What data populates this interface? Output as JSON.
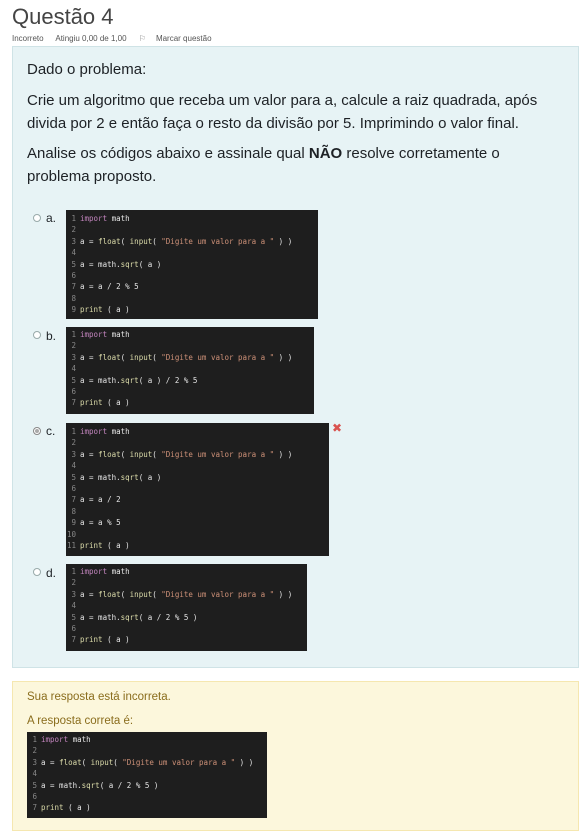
{
  "header": {
    "title": "Questão 4",
    "status": "Incorreto",
    "grade": "Atingiu 0,00 de 1,00",
    "flag_label": "Marcar questão"
  },
  "question": {
    "p1": "Dado o problema:",
    "p2": "Crie um algoritmo que receba um valor para a, calcule a raiz quadrada, após divida por 2 e então faça o resto da divisão por 5. Imprimindo o valor final.",
    "p3_before": "Analise os códigos abaixo e assinale qual ",
    "p3_bold": "NÃO",
    "p3_after": " resolve corretamente o problema proposto."
  },
  "options": [
    {
      "letter": "a.",
      "selected": false,
      "code": [
        {
          "n": "1",
          "t": [
            [
              "kw",
              "import"
            ],
            [
              "",
              " math"
            ]
          ]
        },
        {
          "n": "2",
          "t": []
        },
        {
          "n": "3",
          "t": [
            [
              "",
              "a = "
            ],
            [
              "fn",
              "float"
            ],
            [
              "",
              "( "
            ],
            [
              "fn",
              "input"
            ],
            [
              "",
              "( "
            ],
            [
              "str",
              "\"Digite um valor para a \""
            ],
            [
              "",
              " ) )"
            ]
          ]
        },
        {
          "n": "4",
          "t": []
        },
        {
          "n": "5",
          "t": [
            [
              "",
              "a = math."
            ],
            [
              "fn",
              "sqrt"
            ],
            [
              "",
              "( a )"
            ]
          ]
        },
        {
          "n": "6",
          "t": []
        },
        {
          "n": "7",
          "t": [
            [
              "",
              "a = a / 2 % 5"
            ]
          ]
        },
        {
          "n": "8",
          "t": []
        },
        {
          "n": "9",
          "t": [
            [
              "fn",
              "print"
            ],
            [
              "",
              " ( a )"
            ]
          ]
        }
      ]
    },
    {
      "letter": "b.",
      "selected": false,
      "code": [
        {
          "n": "1",
          "t": [
            [
              "kw",
              "import"
            ],
            [
              "",
              " math"
            ]
          ]
        },
        {
          "n": "2",
          "t": []
        },
        {
          "n": "3",
          "t": [
            [
              "",
              "a = "
            ],
            [
              "fn",
              "float"
            ],
            [
              "",
              "( "
            ],
            [
              "fn",
              "input"
            ],
            [
              "",
              "( "
            ],
            [
              "str",
              "\"Digite um valor para a \""
            ],
            [
              "",
              " ) )"
            ]
          ]
        },
        {
          "n": "4",
          "t": []
        },
        {
          "n": "5",
          "t": [
            [
              "",
              "a = math."
            ],
            [
              "fn",
              "sqrt"
            ],
            [
              "",
              "( a ) / 2 % 5"
            ]
          ]
        },
        {
          "n": "6",
          "t": []
        },
        {
          "n": "7",
          "t": [
            [
              "fn",
              "print"
            ],
            [
              "",
              " ( a )"
            ]
          ]
        }
      ]
    },
    {
      "letter": "c.",
      "selected": true,
      "code": [
        {
          "n": "1",
          "t": [
            [
              "kw",
              "import"
            ],
            [
              "",
              " math"
            ]
          ]
        },
        {
          "n": "2",
          "t": []
        },
        {
          "n": "3",
          "t": [
            [
              "",
              "a = "
            ],
            [
              "fn",
              "float"
            ],
            [
              "",
              "( "
            ],
            [
              "fn",
              "input"
            ],
            [
              "",
              "( "
            ],
            [
              "str",
              "\"Digite um valor para a \""
            ],
            [
              "",
              " ) )"
            ]
          ]
        },
        {
          "n": "4",
          "t": []
        },
        {
          "n": "5",
          "t": [
            [
              "",
              "a = math."
            ],
            [
              "fn",
              "sqrt"
            ],
            [
              "",
              "( a )"
            ]
          ]
        },
        {
          "n": "6",
          "t": []
        },
        {
          "n": "7",
          "t": [
            [
              "",
              "a = a / 2"
            ]
          ]
        },
        {
          "n": "8",
          "t": []
        },
        {
          "n": "9",
          "t": [
            [
              "",
              "a = a % 5"
            ]
          ]
        },
        {
          "n": "10",
          "t": []
        },
        {
          "n": "11",
          "t": [
            [
              "fn",
              "print"
            ],
            [
              "",
              " ( a )"
            ]
          ]
        }
      ]
    },
    {
      "letter": "d.",
      "selected": false,
      "code": [
        {
          "n": "1",
          "t": [
            [
              "kw",
              "import"
            ],
            [
              "",
              " math"
            ]
          ]
        },
        {
          "n": "2",
          "t": []
        },
        {
          "n": "3",
          "t": [
            [
              "",
              "a = "
            ],
            [
              "fn",
              "float"
            ],
            [
              "",
              "( "
            ],
            [
              "fn",
              "input"
            ],
            [
              "",
              "( "
            ],
            [
              "str",
              "\"Digite um valor para a \""
            ],
            [
              "",
              " ) )"
            ]
          ]
        },
        {
          "n": "4",
          "t": []
        },
        {
          "n": "5",
          "t": [
            [
              "",
              "a = math."
            ],
            [
              "fn",
              "sqrt"
            ],
            [
              "",
              "( a / 2 % 5 )"
            ]
          ]
        },
        {
          "n": "6",
          "t": []
        },
        {
          "n": "7",
          "t": [
            [
              "fn",
              "print"
            ],
            [
              "",
              " ( a )"
            ]
          ]
        }
      ]
    }
  ],
  "feedback": {
    "incorrect_msg": "Sua resposta está incorreta.",
    "correct_label": "A resposta correta é:",
    "code": [
      {
        "n": "1",
        "t": [
          [
            "kw",
            "import"
          ],
          [
            "",
            " math"
          ]
        ]
      },
      {
        "n": "2",
        "t": []
      },
      {
        "n": "3",
        "t": [
          [
            "",
            "a = "
          ],
          [
            "fn",
            "float"
          ],
          [
            "",
            "( "
          ],
          [
            "fn",
            "input"
          ],
          [
            "",
            "( "
          ],
          [
            "str",
            "\"Digite um valor para a \""
          ],
          [
            "",
            " ) )"
          ]
        ]
      },
      {
        "n": "4",
        "t": []
      },
      {
        "n": "5",
        "t": [
          [
            "",
            "a = math."
          ],
          [
            "fn",
            "sqrt"
          ],
          [
            "",
            "( a / 2 % 5 )"
          ]
        ]
      },
      {
        "n": "6",
        "t": []
      },
      {
        "n": "7",
        "t": [
          [
            "fn",
            "print"
          ],
          [
            "",
            " ( a )"
          ]
        ]
      }
    ]
  },
  "icons": {
    "flag": "flag-icon",
    "wrong": "x-mark-icon"
  }
}
